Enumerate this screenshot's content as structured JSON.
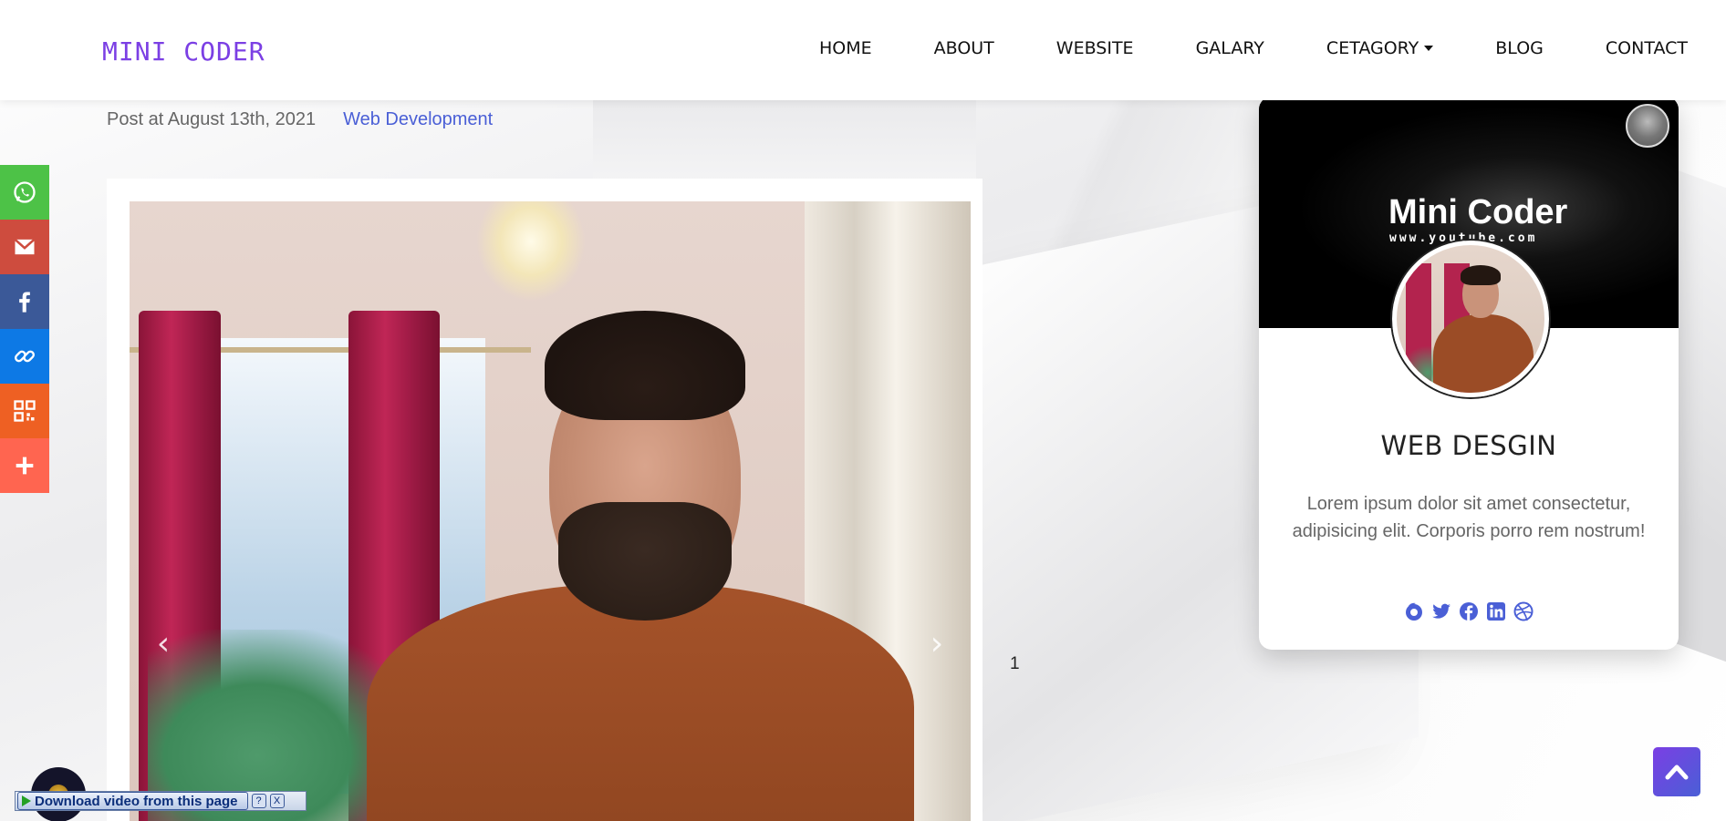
{
  "header": {
    "brand": "MINI CODER",
    "nav": [
      {
        "label": "HOME"
      },
      {
        "label": "ABOUT"
      },
      {
        "label": "WEBSITE"
      },
      {
        "label": "GALARY"
      },
      {
        "label": "CETAGORY",
        "dropdown": true
      },
      {
        "label": "BLOG"
      },
      {
        "label": "CONTACT"
      }
    ]
  },
  "post": {
    "date_text": "Post at August 13th, 2021",
    "category": "Web Development",
    "slide_count": "1",
    "arrows": {
      "prev": "‹",
      "next": "›"
    }
  },
  "share_bar": [
    {
      "icon": "whatsapp-icon",
      "color": "#4dc247"
    },
    {
      "icon": "gmail-icon",
      "color": "#ce4c3e"
    },
    {
      "icon": "facebook-icon",
      "color": "#3b5998"
    },
    {
      "icon": "copy-link-icon",
      "color": "#0d79e5"
    },
    {
      "icon": "qr-code-icon",
      "color": "#ee6023"
    },
    {
      "icon": "more-share-icon",
      "color": "#ff6550"
    }
  ],
  "profile_card": {
    "banner_title": "Mini Coder",
    "banner_subtitle": "www.youtube.com",
    "title": "WEB DESGIN",
    "description": "Lorem ipsum dolor sit amet consectetur, adipisicing elit. Corporis porro rem nostrum!",
    "social_icons": [
      "firefox-icon",
      "twitter-icon",
      "facebook-icon",
      "linkedin-icon",
      "dribbble-icon"
    ],
    "social_color": "#4a5fd6"
  },
  "video_widget": {
    "download_label": "Download video from this page",
    "help": "?",
    "close": "X"
  },
  "colors": {
    "brand": "#7b3fe4",
    "link": "#4a5fd6"
  }
}
